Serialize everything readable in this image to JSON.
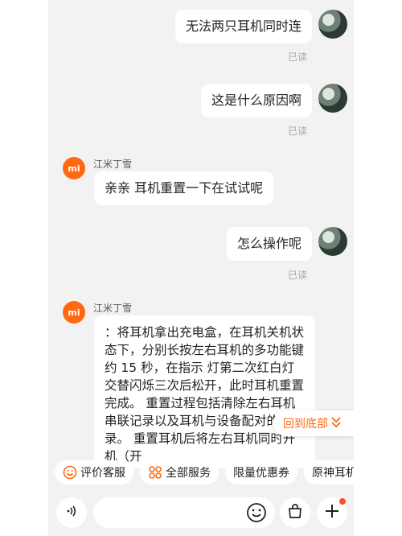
{
  "messages": [
    {
      "from": "user",
      "text": "无法两只耳机同时连",
      "status": "已读"
    },
    {
      "from": "user",
      "text": "这是什么原因啊",
      "status": "已读"
    },
    {
      "from": "agent",
      "name": "江米丁雪",
      "text": "亲亲  耳机重置一下在试试呢"
    },
    {
      "from": "user",
      "text": "怎么操作呢",
      "status": "已读"
    },
    {
      "from": "agent",
      "name": "江米丁雪",
      "text": "：将耳机拿出充电盒，在耳机关机状态下，分别长按左右耳机的多功能键约 15 秒，在指示 灯第二次红白灯交替闪烁三次后松开，此时耳机重置完成。 重置过程包括清除左右耳机串联记录以及耳机与设备配对的记录。 重置耳机后将左右耳机同时开机（开"
    }
  ],
  "agent_logo": "mi",
  "back_to_bottom": "回到底部",
  "quick_actions": [
    "评价客服",
    "全部服务",
    "限量优惠券",
    "原神耳机"
  ],
  "icons": {
    "voice": "voice-icon",
    "emoji": "emoji-icon",
    "bag": "shopping-bag-icon",
    "plus": "plus-icon"
  },
  "colors": {
    "accent": "#ff6a10",
    "notify": "#ff4d2e"
  }
}
